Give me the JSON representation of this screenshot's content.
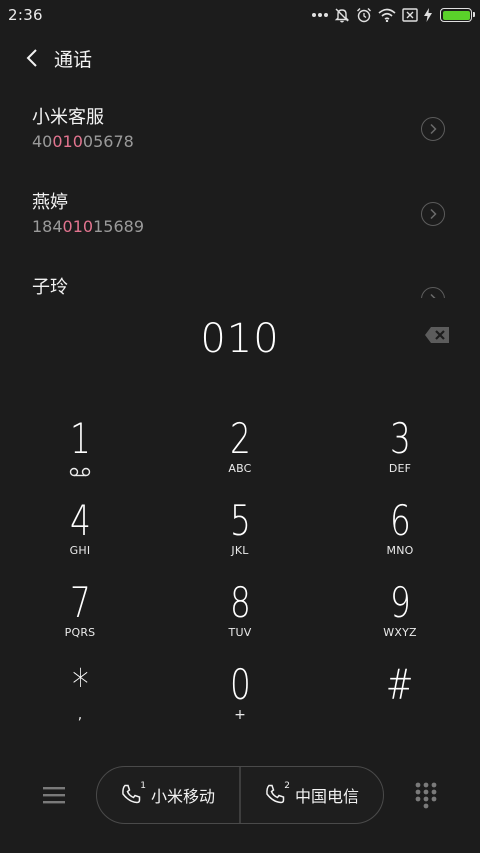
{
  "status_bar": {
    "time": "2:36",
    "battery_level": 1.0,
    "battery_color": "#5ad12a",
    "icons": [
      "more-dots-icon",
      "mute-icon",
      "alarm-icon",
      "wifi-icon",
      "no-sim-icon",
      "charging-icon",
      "battery-icon"
    ]
  },
  "header": {
    "title": "通话",
    "back_icon": "chevron-left-icon"
  },
  "contacts": [
    {
      "name": "小米客服",
      "number_before": "40",
      "number_match": "010",
      "number_after": "05678"
    },
    {
      "name": "燕婷",
      "number_before": "184",
      "number_match": "010",
      "number_after": "15689"
    },
    {
      "name": "子玲",
      "number_before": "",
      "number_match": "",
      "number_after": ""
    }
  ],
  "match_color": "#e2748f",
  "dial": {
    "number": "010",
    "backspace_icon": "backspace-icon"
  },
  "keypad": [
    {
      "digit": "1",
      "letters": "",
      "sub_icon": "voicemail-icon"
    },
    {
      "digit": "2",
      "letters": "ABC"
    },
    {
      "digit": "3",
      "letters": "DEF"
    },
    {
      "digit": "4",
      "letters": "GHI"
    },
    {
      "digit": "5",
      "letters": "JKL"
    },
    {
      "digit": "6",
      "letters": "MNO"
    },
    {
      "digit": "7",
      "letters": "PQRS"
    },
    {
      "digit": "8",
      "letters": "TUV"
    },
    {
      "digit": "9",
      "letters": "WXYZ"
    },
    {
      "digit": "*",
      "letters": ","
    },
    {
      "digit": "0",
      "letters": "+"
    },
    {
      "digit": "#",
      "letters": ""
    }
  ],
  "bottom_bar": {
    "menu_icon": "menu-icon",
    "dialpad_icon": "dialpad-icon",
    "sim1": {
      "slot": "1",
      "label": "小米移动"
    },
    "sim2": {
      "slot": "2",
      "label": "中国电信"
    }
  }
}
